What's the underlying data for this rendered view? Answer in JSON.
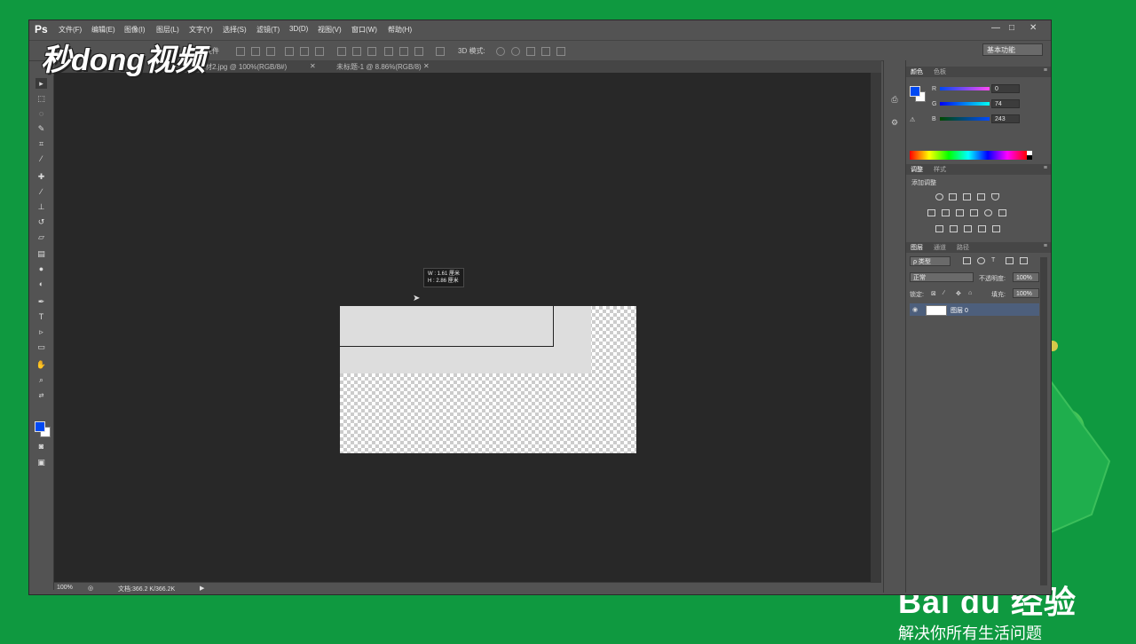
{
  "overlay": {
    "watermark": "秒dong视频",
    "brand_logo": "Bai du 经验",
    "brand_slogan": "解决你所有生活问题"
  },
  "app": {
    "logo": "Ps",
    "menus": [
      "文件(F)",
      "编辑(E)",
      "图像(I)",
      "图层(L)",
      "文字(Y)",
      "选择(S)",
      "滤镜(T)",
      "3D(D)",
      "视图(V)",
      "窗口(W)",
      "帮助(H)"
    ],
    "window_controls": [
      "minimize-icon",
      "maximize-icon",
      "close-icon"
    ]
  },
  "options_bar": {
    "fragment_label": "控件",
    "mode_3d": "3D 模式:",
    "workspace": "基本功能"
  },
  "doc_tabs": [
    {
      "label": "材2.jpg @ 100%(RGB/8#)",
      "closable": true
    },
    {
      "label": "未标题-1 @ 8.86%(RGB/8)",
      "closable": true
    }
  ],
  "tools": [
    "move-tool-icon",
    "marquee-tool-icon",
    "lasso-tool-icon",
    "quick-select-tool-icon",
    "crop-tool-icon",
    "eyedropper-tool-icon",
    "healing-brush-tool-icon",
    "brush-tool-icon",
    "clone-stamp-tool-icon",
    "history-brush-tool-icon",
    "eraser-tool-icon",
    "gradient-tool-icon",
    "blur-tool-icon",
    "dodge-tool-icon",
    "pen-tool-icon",
    "type-tool-icon",
    "path-select-tool-icon",
    "rectangle-tool-icon",
    "hand-tool-icon",
    "zoom-tool-icon"
  ],
  "tool_glyphs": {
    "type": "T"
  },
  "colors": {
    "foreground": "#0049f3",
    "background": "#ffffff"
  },
  "tooltip": {
    "w": "W : 1.61 厘米",
    "h": "H : 2.86 厘米"
  },
  "status": {
    "zoom": "100%",
    "doc_info": "文档:366.2 K/366.2K"
  },
  "color_panel": {
    "tabs": [
      "颜色",
      "色板"
    ],
    "r_label": "R",
    "r": "0",
    "g_label": "G",
    "g": "74",
    "b_label": "B",
    "b": "243"
  },
  "adjust_panel": {
    "tabs": [
      "调整",
      "样式"
    ],
    "title": "添加调整"
  },
  "layers_panel": {
    "tabs": [
      "图层",
      "通道",
      "路径"
    ],
    "filter": "ρ 类型",
    "blend_mode": "正常",
    "opacity_label": "不透明度:",
    "opacity": "100%",
    "lock_label": "锁定:",
    "fill_label": "填充:",
    "fill": "100%",
    "layers": [
      {
        "name": "图层 0",
        "visible": true,
        "selected": true
      }
    ]
  }
}
